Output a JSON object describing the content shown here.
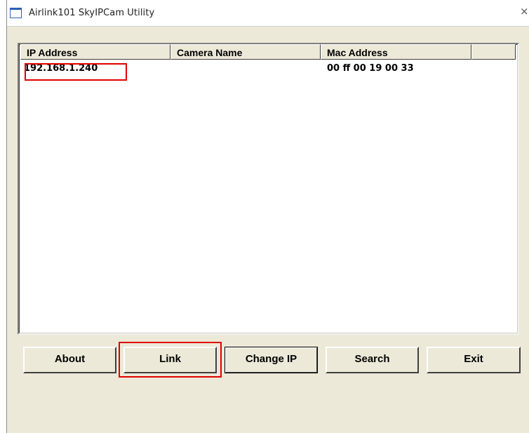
{
  "window": {
    "title": "Airlink101 SkyIPCam Utility",
    "icons": {
      "app": "window-icon",
      "close": "close-icon"
    }
  },
  "table": {
    "columns": [
      "IP Address",
      "Camera Name",
      "Mac Address",
      ""
    ],
    "rows": [
      {
        "ip": "192.168.1.240",
        "name": "",
        "mac": "00 ff 00 19 00 33"
      }
    ]
  },
  "buttons": {
    "about": "About",
    "link": "Link",
    "change_ip": "Change IP",
    "search": "Search",
    "exit": "Exit"
  },
  "colors": {
    "annotation": "#e00000",
    "face": "#ece9d8"
  }
}
